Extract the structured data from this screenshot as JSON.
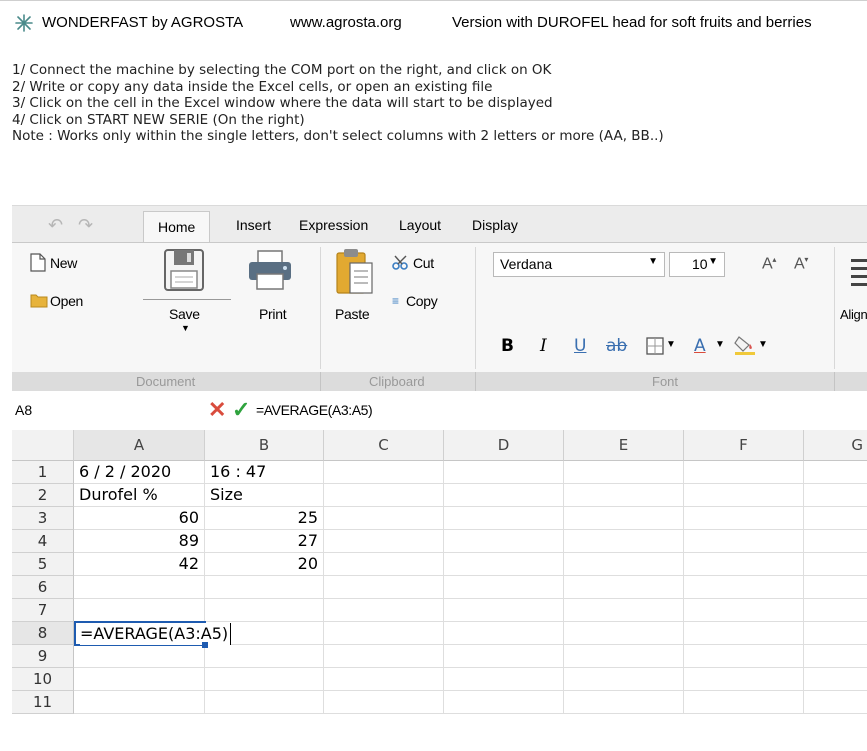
{
  "window": {
    "app_title": "WONDERFAST by AGROSTA",
    "url": "www.agrosta.org",
    "version_text": "Version with DUROFEL head for soft fruits and berries"
  },
  "instructions": [
    "1/ Connect the machine by selecting the COM port on the right, and click on OK",
    "2/ Write or copy any data inside the Excel cells, or open an existing file",
    "3/ Click on the cell in the Excel window where the data will start to be displayed",
    "4/ Click on START NEW SERIE (On the right)",
    "Note : Works only within the single letters, don't select columns with 2 letters or more (AA, BB..)"
  ],
  "ribbon": {
    "tabs": [
      "Home",
      "Insert",
      "Expression",
      "Layout",
      "Display"
    ],
    "active_tab": "Home",
    "document": {
      "label": "Document",
      "new": "New",
      "open": "Open",
      "save": "Save",
      "print": "Print"
    },
    "clipboard": {
      "label": "Clipboard",
      "paste": "Paste",
      "cut": "Cut",
      "copy": "Copy"
    },
    "font": {
      "label": "Font",
      "family": "Verdana",
      "size": "10",
      "bold": "B",
      "italic": "I",
      "underline": "U",
      "strike": "ab",
      "color_a": "A",
      "grow": "A",
      "shrink": "A"
    },
    "align_label": "Align"
  },
  "formula_bar": {
    "cell_ref": "A8",
    "cancel": "✕",
    "confirm": "✓",
    "formula": "=AVERAGE(A3:A5)"
  },
  "sheet": {
    "columns": [
      "A",
      "B",
      "C",
      "D",
      "E",
      "F",
      "G"
    ],
    "rows": [
      "1",
      "2",
      "3",
      "4",
      "5",
      "6",
      "7",
      "8",
      "9",
      "10",
      "11"
    ],
    "cells": {
      "A1": "6 / 2 / 2020",
      "B1": "16 : 47",
      "A2": "Durofel %",
      "B2": "Size",
      "A3": "60",
      "B3": "25",
      "A4": "89",
      "B4": "27",
      "A5": "42",
      "B5": "20",
      "A8": "=AVERAGE(A3:A5)"
    },
    "selected_cell": "A8"
  },
  "colors": {
    "cancel": "#d94c3d",
    "confirm": "#2fa33e",
    "selection": "#1e5bb0"
  }
}
